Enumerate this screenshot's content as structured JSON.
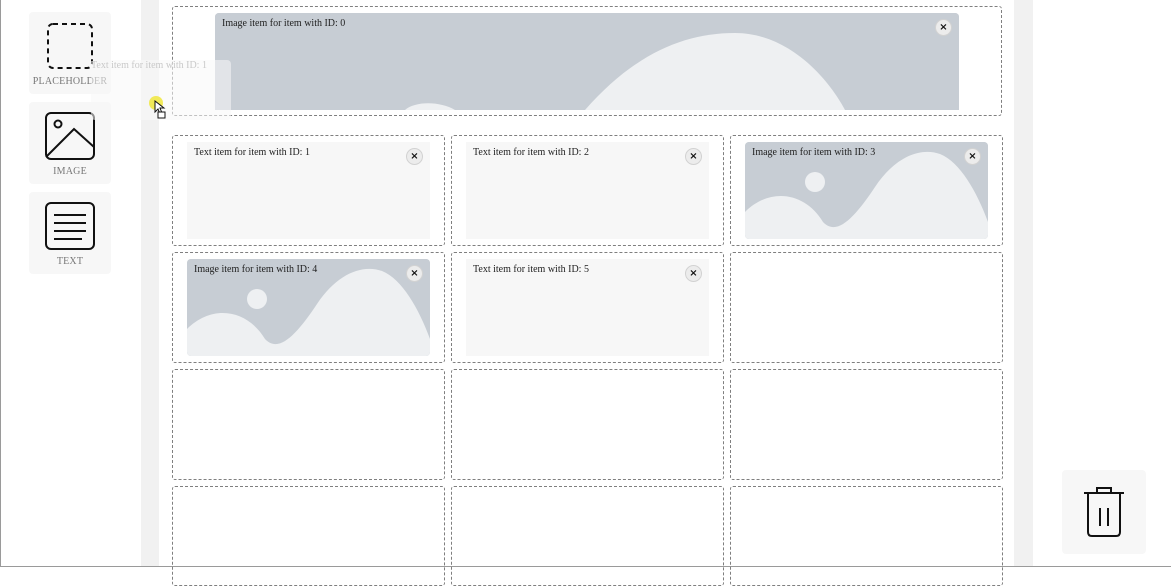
{
  "palette": {
    "items": [
      {
        "label": "PLACEHOLDER",
        "icon": "dashed-square-icon"
      },
      {
        "label": "IMAGE",
        "icon": "image-icon"
      },
      {
        "label": "TEXT",
        "icon": "text-lines-icon"
      }
    ]
  },
  "drag_ghost": {
    "label": "Text item for item with ID: 1"
  },
  "grid": {
    "items": [
      {
        "id": 0,
        "type": "image",
        "label": "Image item for item with ID: 0"
      },
      {
        "id": 1,
        "type": "text",
        "label": "Text item for item with ID: 1"
      },
      {
        "id": 2,
        "type": "text",
        "label": "Text item for item with ID: 2"
      },
      {
        "id": 3,
        "type": "image",
        "label": "Image item for item with ID: 3"
      },
      {
        "id": 4,
        "type": "image",
        "label": "Image item for item with ID: 4"
      },
      {
        "id": 5,
        "type": "text",
        "label": "Text item for item with ID: 5"
      }
    ],
    "close_glyph": "×"
  },
  "trash": {
    "icon": "trash-icon"
  },
  "colors": {
    "image_bg": "#c7cdd4",
    "image_shape": "#eef0f2",
    "text_bg": "#f7f7f7",
    "slot_border": "#7f7f7f"
  }
}
